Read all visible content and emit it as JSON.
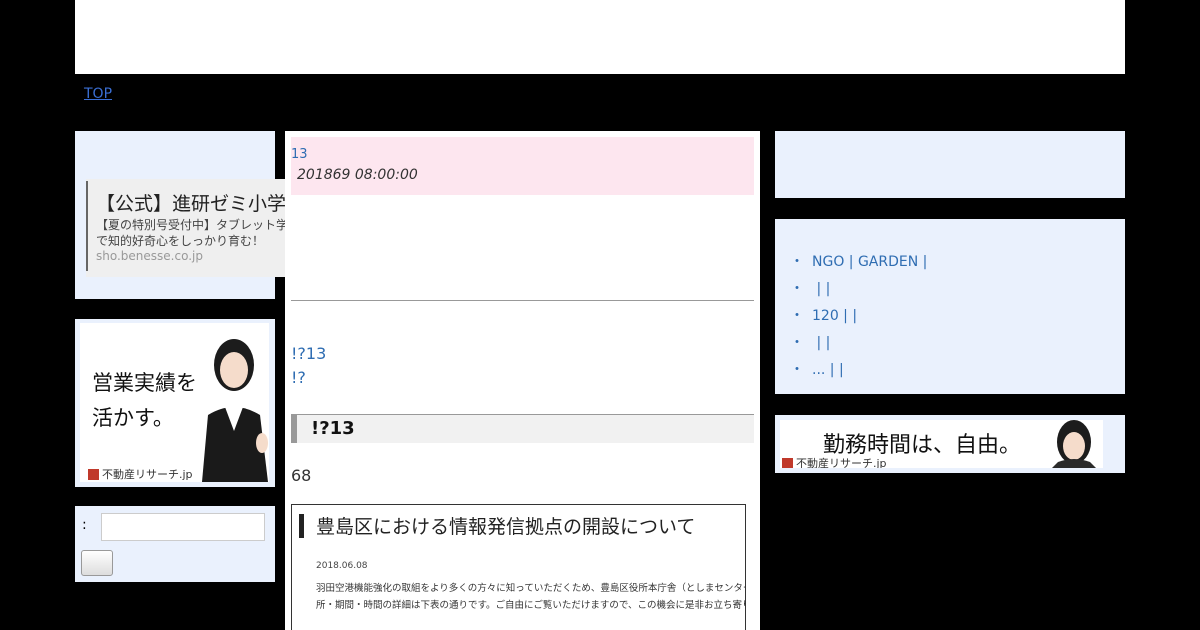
{
  "nav": {
    "top_link": "TOP"
  },
  "ad": {
    "title": "【公式】進研ゼミ小学講座",
    "description": "【夏の特別号受付中】タブレット学習＋体験型教材で知的好奇心をしっかり育む！",
    "domain": "sho.benesse.co.jp",
    "close_glyph": "✕",
    "info_glyph": "ⓘ",
    "arrow_glyph": "❯"
  },
  "banner_left": {
    "line1": "営業実績を",
    "line2": "活かす。",
    "logo": "不動産リサーチ.jp"
  },
  "search": {
    "label": ":",
    "value": "",
    "button_label": ""
  },
  "post": {
    "number": "13",
    "date": "201869 08:00:00",
    "intro_lines": [
      "!?13",
      "!?"
    ],
    "section_title": "!?13",
    "count": "68",
    "screenshot": {
      "title": "豊島区における情報発信拠点の開設について",
      "date": "2018.06.08",
      "line1": "羽田空港機能強化の取組をより多くの方々に知っていただくため、豊島区役所本庁舎（としまセンタースクエア）に",
      "line2": "所・期間・時間の詳細は下表の通りです。ご自由にご覧いただけますので、この機会に是非お立ち寄りください。"
    }
  },
  "recent": {
    "bullet": "・",
    "items": [
      "NGO | GARDEN |",
      " |  |",
      "120 |  |",
      " |  |",
      "... |  |"
    ]
  },
  "banner_right": {
    "text": "勤務時間は、自由。",
    "logo": "不動産リサーチ.jp"
  },
  "colors": {
    "link": "#2f6db2",
    "side_bg": "#eaf1fd",
    "post_head_bg": "#fde6ef"
  }
}
